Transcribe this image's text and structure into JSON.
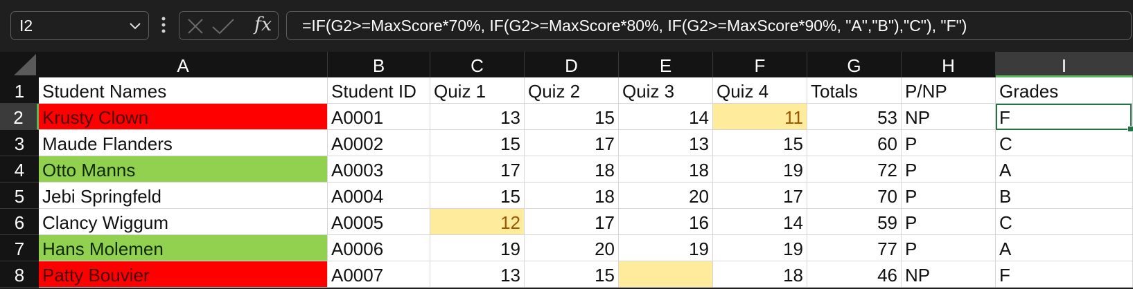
{
  "formula_bar": {
    "name_box": "I2",
    "formula": "=IF(G2>=MaxScore*70%, IF(G2>=MaxScore*80%, IF(G2>=MaxScore*90%, \"A\",\"B\"),\"C\"), \"F\")",
    "fx_label": "fx"
  },
  "columns": [
    "A",
    "B",
    "C",
    "D",
    "E",
    "F",
    "G",
    "H",
    "I"
  ],
  "selected_column": "I",
  "row_numbers": [
    "1",
    "2",
    "3",
    "4",
    "5",
    "6",
    "7",
    "8"
  ],
  "selected_row": "2",
  "header_row": [
    "Student Names",
    "Student ID",
    "Quiz 1",
    "Quiz 2",
    "Quiz 3",
    "Quiz 4",
    "Totals",
    "P/NP",
    "Grades"
  ],
  "rows": [
    {
      "name": "Krusty Clown",
      "id": "A0001",
      "q1": "13",
      "q2": "15",
      "q3": "14",
      "q4": "11",
      "total": "53",
      "pnp": "NP",
      "grade": "F"
    },
    {
      "name": "Maude Flanders",
      "id": "A0002",
      "q1": "15",
      "q2": "17",
      "q3": "13",
      "q4": "15",
      "total": "60",
      "pnp": "P",
      "grade": "C"
    },
    {
      "name": "Otto Manns",
      "id": "A0003",
      "q1": "17",
      "q2": "18",
      "q3": "18",
      "q4": "19",
      "total": "72",
      "pnp": "P",
      "grade": "A"
    },
    {
      "name": "Jebi Springfeld",
      "id": "A0004",
      "q1": "15",
      "q2": "18",
      "q3": "20",
      "q4": "17",
      "total": "70",
      "pnp": "P",
      "grade": "B"
    },
    {
      "name": "Clancy Wiggum",
      "id": "A0005",
      "q1": "12",
      "q2": "17",
      "q3": "16",
      "q4": "14",
      "total": "59",
      "pnp": "P",
      "grade": "C"
    },
    {
      "name": "Hans Molemen",
      "id": "A0006",
      "q1": "19",
      "q2": "20",
      "q3": "19",
      "q4": "19",
      "total": "77",
      "pnp": "P",
      "grade": "A"
    },
    {
      "name": "Patty Bouvier",
      "id": "A0007",
      "q1": "13",
      "q2": "15",
      "q3": "",
      "q4": "18",
      "total": "46",
      "pnp": "NP",
      "grade": "F"
    }
  ],
  "conditional_formats": {
    "fail_fill": "#ff0000",
    "top_fill": "#92d050",
    "low_quiz_fill": "#ffeb9c",
    "highlighted": {
      "name_red_rows": [
        1,
        7
      ],
      "name_green_rows": [
        3,
        6
      ],
      "yellow_cells": [
        "F2",
        "C6",
        "E8"
      ]
    }
  },
  "accent_color": "#217346"
}
